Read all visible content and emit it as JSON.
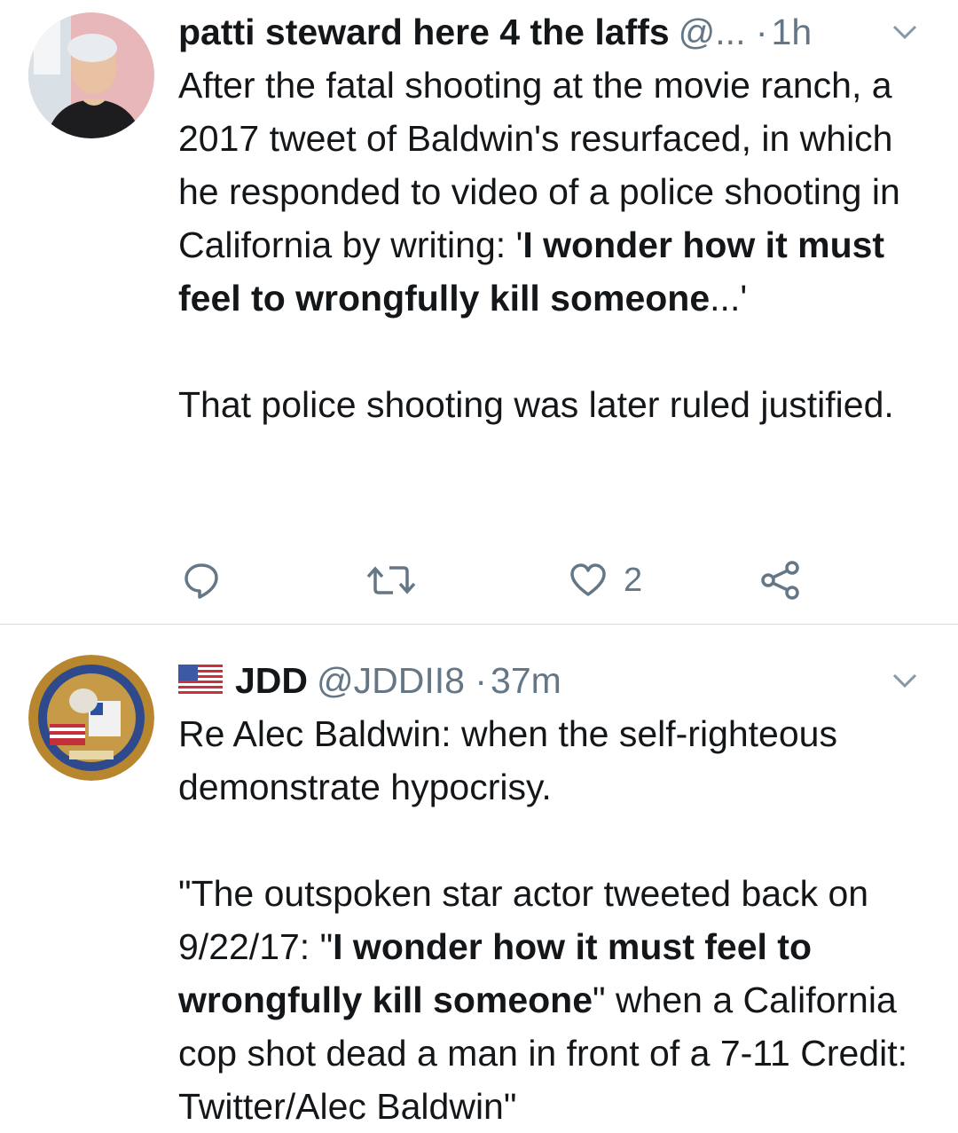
{
  "tweets": [
    {
      "display_name": "patti steward here 4 the laffs",
      "handle": "@...",
      "separator": "·",
      "time": "1h",
      "body_plain_1": "After the fatal shooting at the movie ranch, a 2017 tweet of Baldwin's resurfaced, in which he responded to video of a police shooting in California by writing: '",
      "body_bold_1": "I wonder how it must feel to wrongfully kill someone",
      "body_plain_2": "...'",
      "body_paragraph_2": "That police shooting was later ruled justified.",
      "actions": {
        "reply_icon": "reply-icon",
        "retweet_icon": "retweet-icon",
        "like_icon": "heart-icon",
        "like_count": "2",
        "share_icon": "share-icon"
      }
    },
    {
      "display_name": "JDD",
      "flag_icon": "us-flag-icon",
      "handle": "@JDDII8",
      "separator": "·",
      "time": "37m",
      "body_paragraph_1": "Re Alec Baldwin:  when the self-righteous demonstrate hypocrisy.",
      "body_plain_1": "\"The outspoken star actor tweeted back on 9/22/17: \"",
      "body_bold_1": "I wonder how it must feel to wrongfully kill someone",
      "body_plain_2": "\" when a California cop shot dead a man in front of a 7-11 Credit: Twitter/Alec Baldwin\""
    }
  ],
  "colors": {
    "text": "#14171a",
    "secondary": "#657786",
    "divider": "#d6d9dc"
  }
}
